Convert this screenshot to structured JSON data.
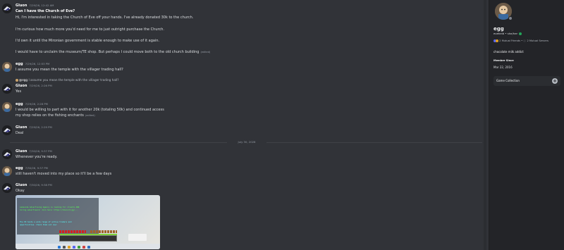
{
  "messages": [
    {
      "author": "Gluon",
      "timestamp": "7/29/26, 12:42 AM"
    },
    {
      "author": "egg",
      "timestamp": "7/29/26, 12:53 PM"
    },
    {
      "author": "Gluon",
      "timestamp": "7/29/26, 2:26 PM"
    },
    {
      "author": "egg",
      "timestamp": "7/29/26, 2:28 PM"
    },
    {
      "author": "Gluon",
      "timestamp": "7/29/26, 2:29 PM"
    },
    {
      "author": "Gluon",
      "timestamp": "7/30/26, 9:37 PM"
    },
    {
      "author": "egg",
      "timestamp": "7/30/26, 9:37 PM"
    },
    {
      "author": "Gluon",
      "timestamp": "7/30/26, 9:38 PM"
    }
  ],
  "lines": {
    "m0_l0": "Can I have the Church of Eve?",
    "m0_l1": "Hi, I'm interested in taking the Church of Eve off your hands. I've already donated 30k to the church.",
    "m0_l2": "I'm curious how much more you'd need for me to just outright purchase the Church.",
    "m0_l3": "I'd own it until the Mironian government is stable enough to make use of it again.",
    "m0_l4": "I would have to unclaim the museum/TE shop. But perhaps I could move both to the old church building",
    "m1_l0": "I assume you mean the temple with the villager trading hall?",
    "m2_reply_author": "@egg",
    "m2_reply_text": "I assume you mean the temple with the villager trading hall?",
    "m2_l0": "Yes",
    "m3_l0": "I would be willing to part with it for another 20k (totaling 50k) and continued access",
    "m3_l1": "my shop relies on the fishing enchants",
    "m4_l0": "Deal",
    "m5_l0": "Whenever you're ready.",
    "m6_l0": "still haven't moved into my place so it'll be a few days",
    "m7_l0": "Okay"
  },
  "edited_label": "(edited)",
  "date_divider": "July 30, 2026",
  "screenshot_chat": [
    {
      "text": "Lakeside Advertising Agency is looking for clients AND",
      "color": "#55ff55"
    },
    {
      "text": "hiring advertisers! Join here: https://discord.gg/...",
      "color": "#55ff55"
    },
    {
      "text": "The PO hosts a wide range of active traders and",
      "color": "#55ffff"
    },
    {
      "text": "opportunities. Check them out now:",
      "color": "#55ffff"
    }
  ],
  "profile": {
    "display_name": "egg",
    "username": "eveheld",
    "pronouns": "she/her",
    "mutual_friends": "2 Mutual Friends",
    "mutual_servers": "2 Mutual Servers",
    "bio": "chocolate milk addict",
    "member_since_label": "Member Since",
    "member_since": "Mar 22, 2016",
    "game_collection": "Game Collection"
  },
  "colors": {
    "background": "#313338",
    "sidebar": "#232428",
    "online_green": "#23a559"
  }
}
